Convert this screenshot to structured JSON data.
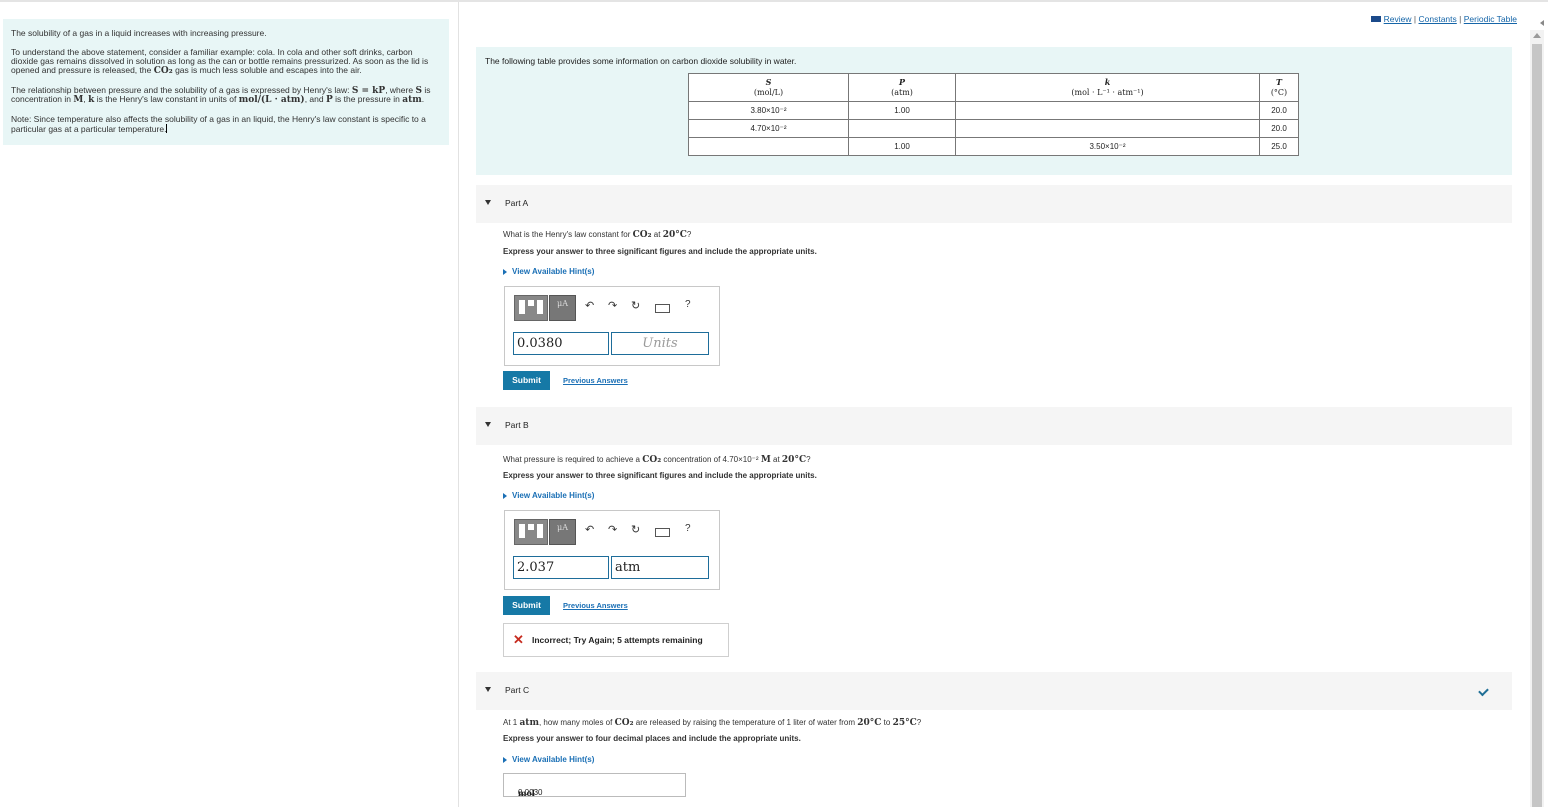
{
  "links": {
    "review": "Review",
    "sep1": "|",
    "constants": "Constants",
    "sep2": "|",
    "periodic": "Periodic Table"
  },
  "intro": {
    "p1": "The solubility of a gas in a liquid increases with increasing pressure.",
    "p2a": "To understand the above statement, consider a familiar example: cola. In cola and other soft drinks, carbon",
    "p2b": "dioxide gas remains dissolved in solution as long as the can or bottle remains pressurized. As soon as the lid is",
    "p2c_pre": "opened and pressure is released, the",
    "p2c_math": "CO₂",
    "p2c_post": "gas is much less soluble and escapes into the air.",
    "p3a_pre": "The relationship between pressure and the solubility of a gas is expressed by Henry's law:",
    "p3a_math": "S = kP",
    "p3a_mid": ", where",
    "p3a_s": "S",
    "p3a_post": "is",
    "p3b_pre": "concentration in",
    "p3b_m": "M",
    "p3b_mid1": ",",
    "p3b_k": "k",
    "p3b_mid2": "is the Henry's law constant in units of",
    "p3b_units": "mol/(L · atm)",
    "p3b_mid3": ", and",
    "p3b_p": "P",
    "p3b_mid4": "is the pressure in",
    "p3b_atm": "atm",
    "p3b_end": ".",
    "p4a": "Note: Since temperature also affects the solubility of a gas in an liquid, the Henry's law constant is specific to a",
    "p4b": "particular gas at a particular temperature."
  },
  "table": {
    "caption": "The following table provides some information on carbon dioxide solubility in water.",
    "headers": [
      {
        "sym": "S",
        "unit": "(mol/L)"
      },
      {
        "sym": "P",
        "unit": "(atm)"
      },
      {
        "sym": "k",
        "unit": "(mol · L⁻¹ · atm⁻¹)"
      },
      {
        "sym": "T",
        "unit": "(°C)"
      }
    ],
    "rows": [
      [
        "3.80×10⁻²",
        "1.00",
        "",
        "20.0"
      ],
      [
        "4.70×10⁻²",
        "",
        "",
        "20.0"
      ],
      [
        "",
        "1.00",
        "3.50×10⁻²",
        "25.0"
      ]
    ]
  },
  "partA": {
    "label": "Part A",
    "question_pre": "What is the Henry's law constant for",
    "question_math": "CO₂",
    "question_mid": "at",
    "question_temp": "20°C",
    "question_end": "?",
    "instruction": "Express your answer to three significant figures and include the appropriate units.",
    "hint": "View Available Hint(s)",
    "value": "0.0380",
    "units_placeholder": "Units",
    "submit": "Submit",
    "previous": "Previous Answers"
  },
  "partB": {
    "label": "Part B",
    "question_pre": "What pressure is required to achieve a",
    "question_math": "CO₂",
    "question_mid": "concentration of 4.70×10⁻²",
    "question_m": "M",
    "question_at": "at",
    "question_temp": "20°C",
    "question_end": "?",
    "instruction": "Express your answer to three significant figures and include the appropriate units.",
    "hint": "View Available Hint(s)",
    "value": "2.037",
    "units": "atm",
    "submit": "Submit",
    "previous": "Previous Answers",
    "feedback": "Incorrect; Try Again; 5 attempts remaining"
  },
  "partC": {
    "label": "Part C",
    "question_pre": "At 1",
    "question_atm": "atm",
    "question_mid": ", how many moles of",
    "question_math": "CO₂",
    "question_mid2": "are released by raising the temperature of 1 liter of water from",
    "question_t1": "20°C",
    "question_to": "to",
    "question_t2": "25°C",
    "question_end": "?",
    "instruction": "Express your answer to four decimal places and include the appropriate units.",
    "hint": "View Available Hint(s)",
    "answer_value": "0.0030",
    "answer_unit": "mol"
  },
  "icons": [
    "book-icon",
    "template-icon",
    "mu-icon",
    "undo-icon",
    "redo-icon",
    "reset-icon",
    "keyboard-icon",
    "help-icon",
    "caret-down-icon",
    "check-icon",
    "x-icon",
    "scroll-up-icon"
  ],
  "colors": {
    "panel_bg": "#e8f6f6",
    "submit_bg": "#1679a6",
    "link": "#1a6fb5",
    "error": "#c62b1f"
  }
}
